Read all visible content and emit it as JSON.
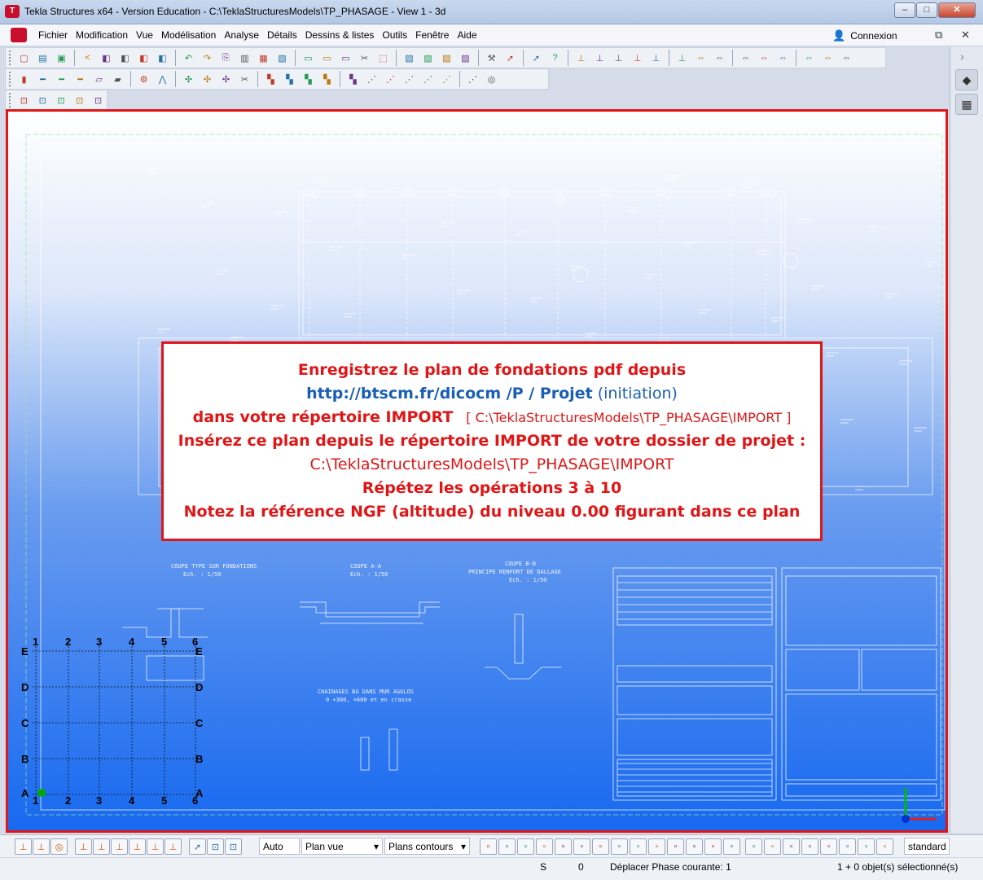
{
  "window": {
    "title": "Tekla Structures x64 - Version Education - C:\\TeklaStructuresModels\\TP_PHASAGE  - View 1 - 3d",
    "minimize": "–",
    "maximize": "□",
    "close": "✕"
  },
  "menu": {
    "items": [
      "Fichier",
      "Modification",
      "Vue",
      "Modélisation",
      "Analyse",
      "Détails",
      "Dessins & listes",
      "Outils",
      "Fenêtre",
      "Aide"
    ],
    "connexion": "Connexion",
    "restore": "⧉",
    "close": "✕"
  },
  "toolbars": {
    "row1_icons": [
      "new-icon",
      "open-icon",
      "save-icon",
      "share-icon",
      "cube-icon",
      "cube-icon",
      "cube-icon",
      "cube-icon",
      "undo-icon",
      "redo-icon",
      "copy-icon",
      "paste-icon",
      "print-icon",
      "template-icon",
      "window-icon",
      "window-icon",
      "window-icon",
      "cut-icon",
      "select-icon",
      "drawing-icon",
      "drawing-icon",
      "drawing-icon",
      "drawing-icon",
      "tool-icon",
      "arrow-icon",
      "arrow-icon",
      "help-icon",
      "snap-icon",
      "snap-icon",
      "snap-icon",
      "snap-icon",
      "snap-icon",
      "snap-icon",
      "measure-icon",
      "measure-icon",
      "measure-icon",
      "measure-icon",
      "measure-icon",
      "measure-icon",
      "measure-icon",
      "measure-icon"
    ],
    "row2_icons": [
      "column-icon",
      "beam-icon",
      "beam-icon",
      "beam-icon",
      "slab-icon",
      "panel-icon",
      "bolt-icon",
      "weld-icon",
      "component-icon",
      "component-icon",
      "component-icon",
      "cut-icon",
      "fitting-icon",
      "fitting-icon",
      "fitting-icon",
      "fitting-icon",
      "fitting-icon",
      "point-icon",
      "point-icon",
      "point-icon",
      "point-icon",
      "point-icon",
      "point-icon",
      "circle-icon"
    ],
    "row3_icons": [
      "view-icon",
      "view-icon",
      "view-icon",
      "view-icon",
      "view-icon"
    ]
  },
  "message": {
    "line1": "Enregistrez  le plan de fondations pdf  depuis",
    "line2_link": "http://btscm.fr/dicocm /P / Projet",
    "line2_suffix": " (initiation)",
    "line3_bold": "dans votre répertoire IMPORT",
    "line3_path": "[ C:\\TeklaStructuresModels\\TP_PHASAGE\\IMPORT  ]",
    "line4": "Insérez ce plan depuis le répertoire IMPORT de votre dossier de projet :",
    "line5": "C:\\TeklaStructuresModels\\TP_PHASAGE\\IMPORT",
    "line6": "Répétez les opérations 3 à 10",
    "line7": "Notez la référence NGF (altitude) du niveau 0.00 figurant dans ce plan"
  },
  "drawing_labels": {
    "coupe1_title": "COUPE TYPE SUR FONDATIONS",
    "coupe1_scale": "Ech. : 1/50",
    "coupe2_title": "COUPE A-A",
    "coupe2_scale": "Ech. : 1/50",
    "coupe3_title": "COUPE B-B",
    "coupe3_subtitle": "PRINCIPE RENFORT DE DALLAGE",
    "coupe3_scale": "Ech. : 1/50",
    "chainage_title": "CHAINAGES BA DANS MUR AGGLOS",
    "chainage_sub": "0 +300, +600 et en crasse"
  },
  "grid": {
    "columns": [
      "1",
      "2",
      "3",
      "4",
      "5",
      "6"
    ],
    "rows": [
      "E",
      "D",
      "C",
      "B",
      "A"
    ]
  },
  "bottom_toolbar": {
    "select_auto": "Auto",
    "select_plan": "Plan vue",
    "select_contours": "Plans contours",
    "standard": "standard"
  },
  "status": {
    "s_label": "S",
    "zero": "0",
    "phase": "Déplacer Phase courante: 1",
    "selection": "1 + 0 objet(s) sélectionné(s)"
  },
  "colors": {
    "accent_red": "#e01616",
    "link_blue": "#1a5fb4",
    "viewport_blue": "#1769f0"
  }
}
